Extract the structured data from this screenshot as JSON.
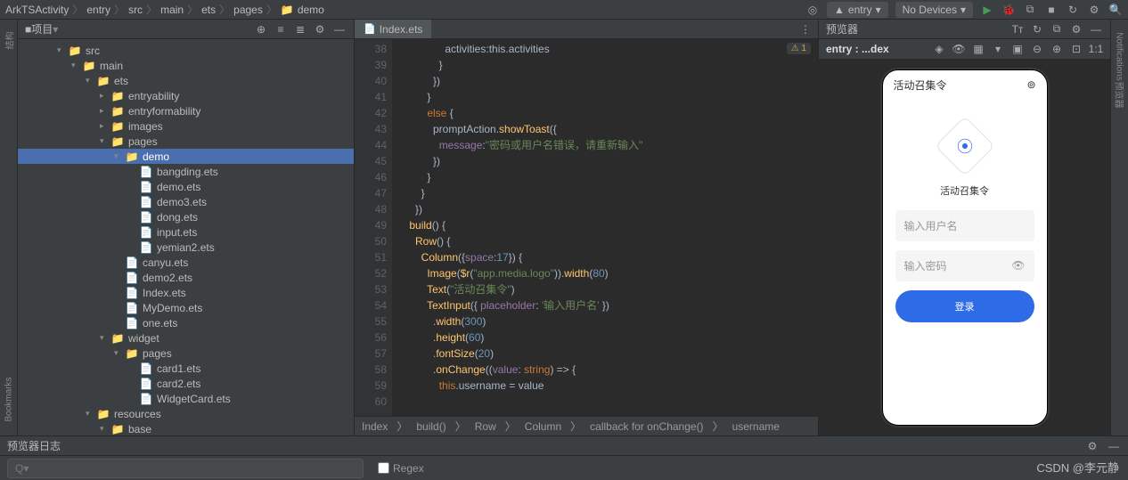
{
  "breadcrumb": [
    "ArkTSActivity",
    "entry",
    "src",
    "main",
    "ets",
    "pages",
    "demo"
  ],
  "topbar": {
    "module": "entry",
    "devices": "No Devices"
  },
  "panel": {
    "title": "项目"
  },
  "tree": [
    {
      "indent": 44,
      "chev": "▾",
      "icon": "folder",
      "label": "src"
    },
    {
      "indent": 60,
      "chev": "▾",
      "icon": "folder",
      "label": "main"
    },
    {
      "indent": 76,
      "chev": "▾",
      "icon": "folder",
      "label": "ets"
    },
    {
      "indent": 92,
      "chev": "▸",
      "icon": "folder",
      "label": "entryability"
    },
    {
      "indent": 92,
      "chev": "▸",
      "icon": "folder",
      "label": "entryformability"
    },
    {
      "indent": 92,
      "chev": "▸",
      "icon": "folder",
      "label": "images"
    },
    {
      "indent": 92,
      "chev": "▾",
      "icon": "folder",
      "label": "pages"
    },
    {
      "indent": 108,
      "chev": "▾",
      "icon": "folder",
      "label": "demo",
      "selected": true
    },
    {
      "indent": 124,
      "chev": "",
      "icon": "file",
      "label": "bangding.ets"
    },
    {
      "indent": 124,
      "chev": "",
      "icon": "file",
      "label": "demo.ets"
    },
    {
      "indent": 124,
      "chev": "",
      "icon": "file",
      "label": "demo3.ets"
    },
    {
      "indent": 124,
      "chev": "",
      "icon": "file",
      "label": "dong.ets"
    },
    {
      "indent": 124,
      "chev": "",
      "icon": "file",
      "label": "input.ets"
    },
    {
      "indent": 124,
      "chev": "",
      "icon": "file",
      "label": "yemian2.ets"
    },
    {
      "indent": 108,
      "chev": "",
      "icon": "file",
      "label": "canyu.ets"
    },
    {
      "indent": 108,
      "chev": "",
      "icon": "file",
      "label": "demo2.ets"
    },
    {
      "indent": 108,
      "chev": "",
      "icon": "file",
      "label": "Index.ets"
    },
    {
      "indent": 108,
      "chev": "",
      "icon": "file",
      "label": "MyDemo.ets"
    },
    {
      "indent": 108,
      "chev": "",
      "icon": "file",
      "label": "one.ets"
    },
    {
      "indent": 92,
      "chev": "▾",
      "icon": "folder",
      "label": "widget"
    },
    {
      "indent": 108,
      "chev": "▾",
      "icon": "folder",
      "label": "pages"
    },
    {
      "indent": 124,
      "chev": "",
      "icon": "file",
      "label": "card1.ets"
    },
    {
      "indent": 124,
      "chev": "",
      "icon": "file",
      "label": "card2.ets"
    },
    {
      "indent": 124,
      "chev": "",
      "icon": "file",
      "label": "WidgetCard.ets"
    },
    {
      "indent": 76,
      "chev": "▾",
      "icon": "folder",
      "label": "resources"
    },
    {
      "indent": 92,
      "chev": "▾",
      "icon": "folder",
      "label": "base"
    },
    {
      "indent": 108,
      "chev": "▸",
      "icon": "folder",
      "label": "element"
    }
  ],
  "tab": {
    "name": "Index.ets"
  },
  "warn": {
    "text": "⚠ 1"
  },
  "gutter": [
    "",
    "38",
    "39",
    "40",
    "41",
    "42",
    "43",
    "44",
    "45",
    "46",
    "47",
    "48",
    "49",
    "50",
    "51",
    "52",
    "53",
    "54",
    "55",
    "56",
    "57",
    "58",
    "59",
    "60"
  ],
  "code": {
    "l0": "                activities:this.activities",
    "l1": "              }",
    "l2": "            })",
    "l3": "          }",
    "l4a": "          ",
    "l4b": "else",
    "l4c": " {",
    "l5a": "            promptAction.",
    "l5b": "showToast",
    "l5c": "({",
    "l6a": "              ",
    "l6b": "message",
    "l6c": ":",
    "l6d": "\"密码或用户名错误，请重新输入\"",
    "l7": "            })",
    "l8": "          }",
    "l9": "        }",
    "l10": "      })",
    "l11": "",
    "l12": "",
    "l13a": "    ",
    "l13b": "build",
    "l13c": "() {",
    "l14a": "      ",
    "l14b": "Row",
    "l14c": "() {",
    "l15a": "        ",
    "l15b": "Column",
    "l15c": "({",
    "l15d": "space",
    "l15e": ":",
    "l15f": "17",
    "l15g": "}) {",
    "l16a": "          ",
    "l16b": "Image",
    "l16c": "(",
    "l16d": "$r",
    "l16e": "(",
    "l16f": "\"app.media.logo\"",
    "l16g": ")).",
    "l16h": "width",
    "l16i": "(",
    "l16j": "80",
    "l16k": ")",
    "l17a": "          ",
    "l17b": "Text",
    "l17c": "(",
    "l17d": "\"活动召集令\"",
    "l17e": ")",
    "l18a": "          ",
    "l18b": "TextInput",
    "l18c": "({ ",
    "l18d": "placeholder",
    "l18e": ": ",
    "l18f": "'输入用户名'",
    "l18g": " })",
    "l19a": "            .",
    "l19b": "width",
    "l19c": "(",
    "l19d": "300",
    "l19e": ")",
    "l20a": "            .",
    "l20b": "height",
    "l20c": "(",
    "l20d": "60",
    "l20e": ")",
    "l21a": "            .",
    "l21b": "fontSize",
    "l21c": "(",
    "l21d": "20",
    "l21e": ")",
    "l22a": "            .",
    "l22b": "onChange",
    "l22c": "((",
    "l22d": "value",
    "l22e": ": ",
    "l22f": "string",
    "l22g": ") => {",
    "l23a": "              ",
    "l23b": "this",
    "l23c": ".username = value"
  },
  "crumbs": [
    "Index",
    "build()",
    "Row",
    "Column",
    "callback for onChange()",
    "username"
  ],
  "preview": {
    "title": "预览器",
    "device": "entry : ...dex"
  },
  "phone": {
    "header": "活动召集令",
    "title": "活动召集令",
    "ph1": "输入用户名",
    "ph2": "输入密码",
    "login": "登录"
  },
  "bottom": {
    "title": "预览器日志",
    "search": "Q▾",
    "regex": "Regex"
  },
  "leftRail": {
    "l1": "结构",
    "l2": "Bookmarks"
  },
  "rightRail": {
    "l1": "Notifications",
    "l2": "预览器"
  },
  "watermark": "CSDN @李元静"
}
